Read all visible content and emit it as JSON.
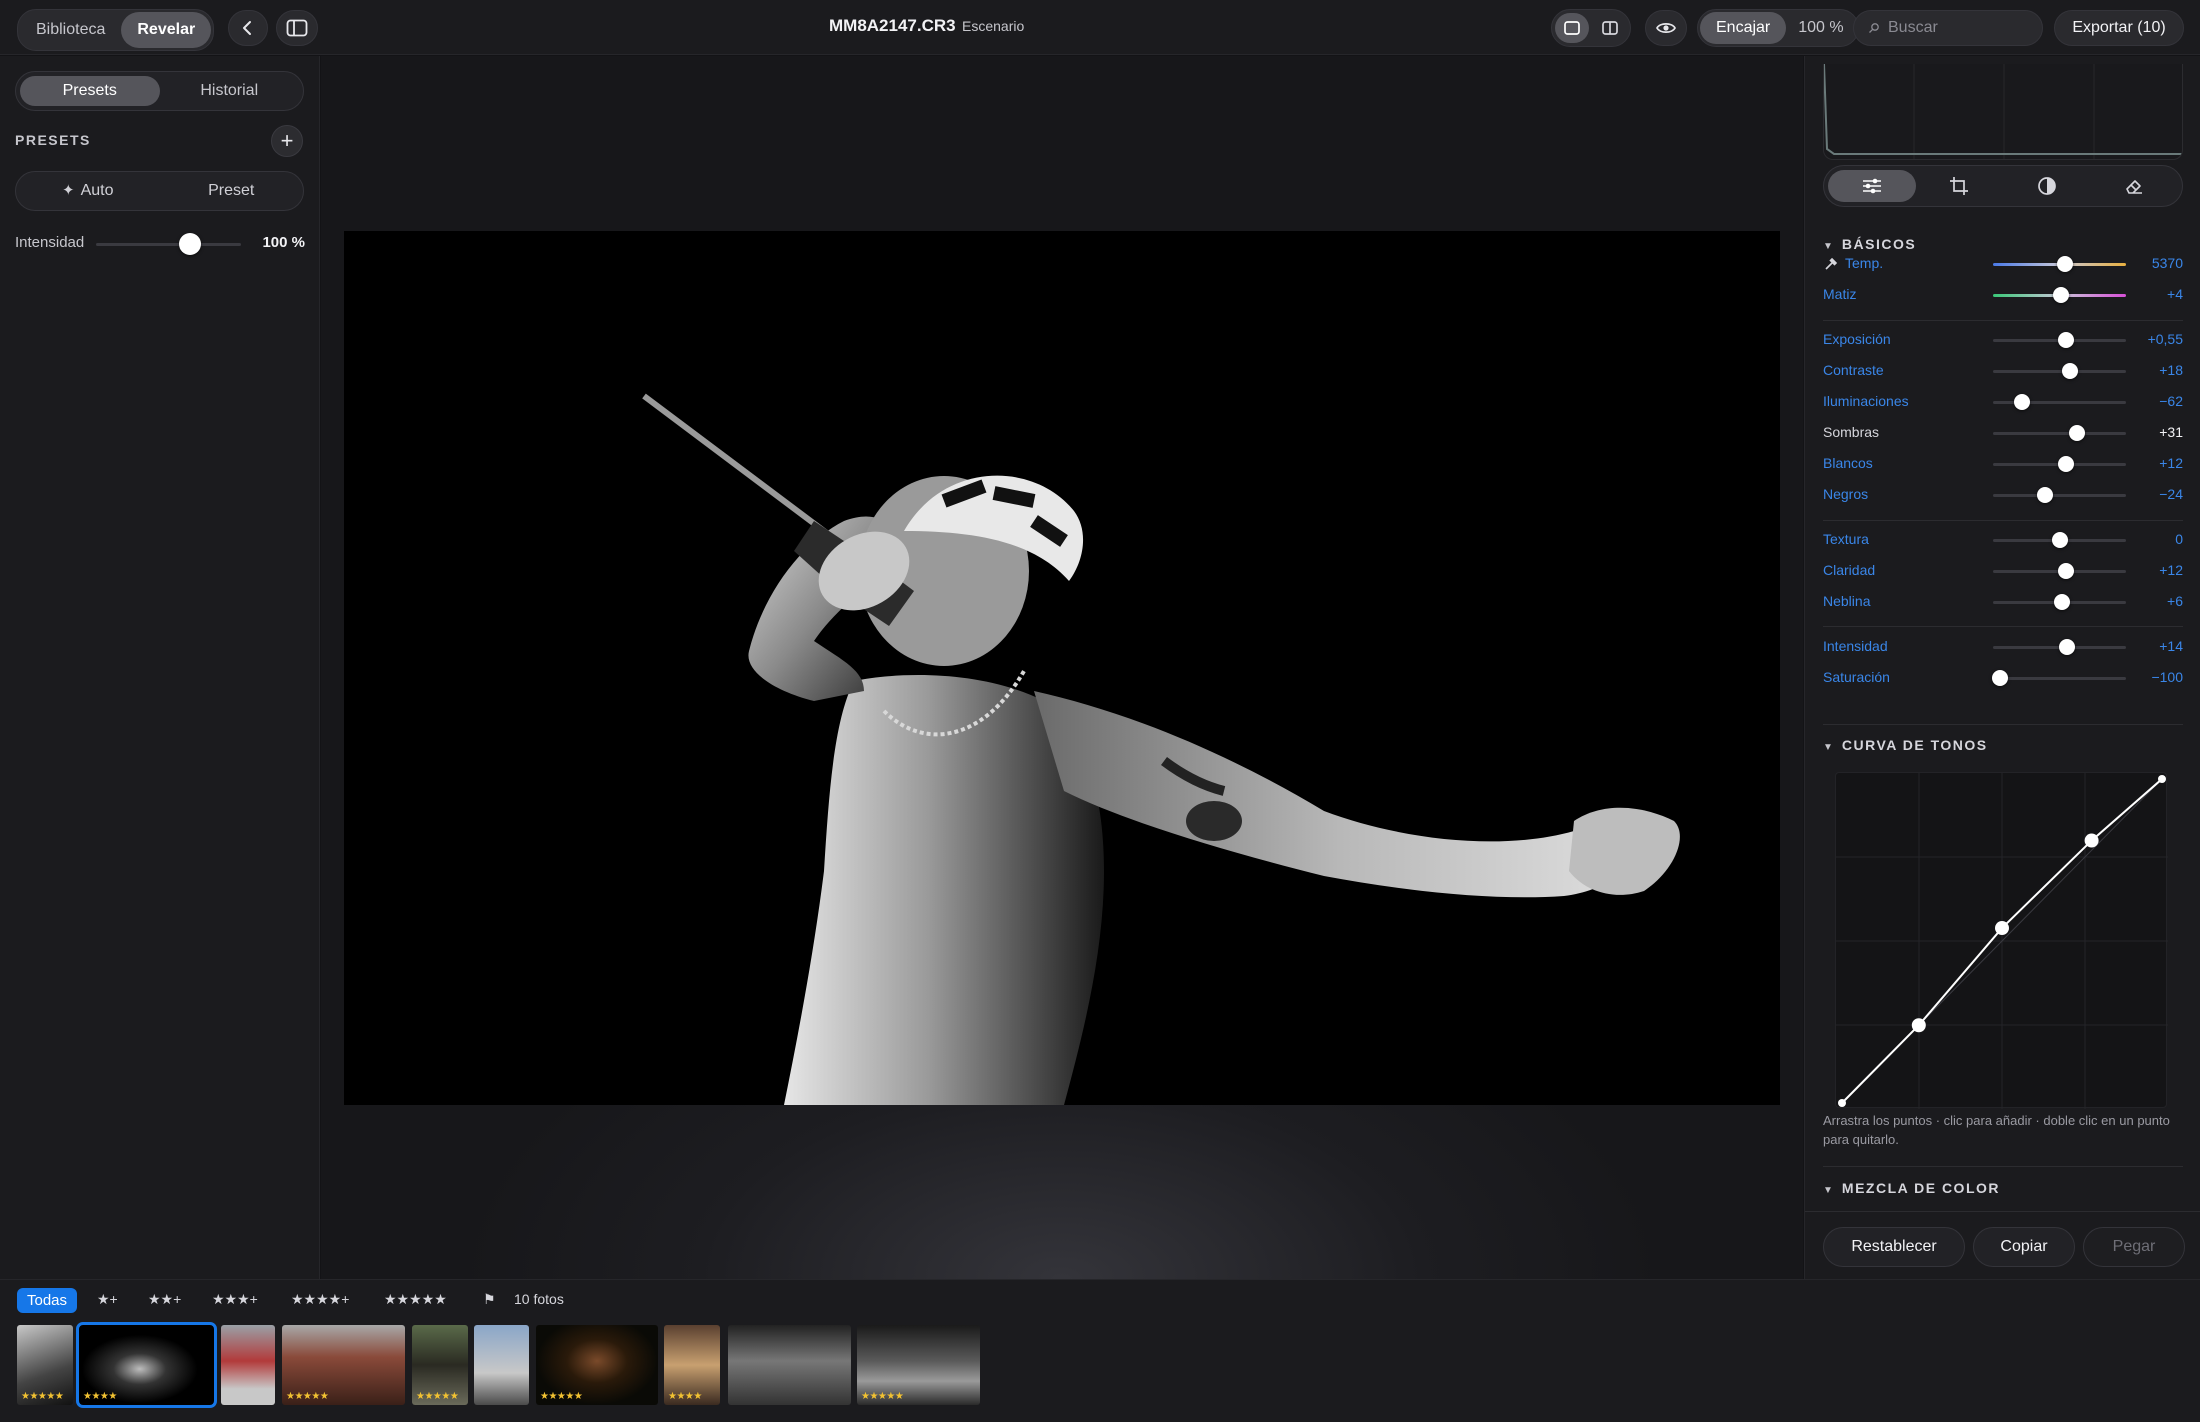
{
  "topbar": {
    "mode_tabs": [
      "Biblioteca",
      "Revelar"
    ],
    "file_title": "MM8A2147.CR3",
    "file_subtitle": "Escenario",
    "fit_label": "Encajar",
    "zoom_label": "100 %",
    "search_placeholder": "Buscar",
    "export_label": "Exportar (10)"
  },
  "left": {
    "tabs": [
      "Presets",
      "Historial"
    ],
    "presets_heading": "PRESETS",
    "add_symbol": "+",
    "auto_label": "Auto",
    "preset_label": "Preset",
    "intensity_label": "Intensidad",
    "intensity_value": "100 %",
    "intensity_fraction": 1.0
  },
  "right": {
    "basics_heading": "BÁSICOS",
    "adjustments": [
      {
        "label": "Temp.",
        "value": "5370",
        "pos": 0.54,
        "track": "temp",
        "changed": true
      },
      {
        "label": "Matiz",
        "value": "+4",
        "pos": 0.51,
        "track": "tint",
        "changed": true
      },
      {
        "label": "Exposición",
        "value": "+0,55",
        "pos": 0.55,
        "changed": true
      },
      {
        "label": "Contraste",
        "value": "+18",
        "pos": 0.58,
        "changed": true
      },
      {
        "label": "Iluminaciones",
        "value": "−62",
        "pos": 0.22,
        "changed": true
      },
      {
        "label": "Sombras",
        "value": "+31",
        "pos": 0.63,
        "changed": false
      },
      {
        "label": "Blancos",
        "value": "+12",
        "pos": 0.55,
        "changed": true
      },
      {
        "label": "Negros",
        "value": "−24",
        "pos": 0.39,
        "changed": true
      },
      {
        "label": "Textura",
        "value": "0",
        "pos": 0.5,
        "changed": true
      },
      {
        "label": "Claridad",
        "value": "+12",
        "pos": 0.55,
        "changed": true
      },
      {
        "label": "Neblina",
        "value": "+6",
        "pos": 0.52,
        "changed": true
      },
      {
        "label": "Intensidad",
        "value": "+14",
        "pos": 0.56,
        "changed": true
      },
      {
        "label": "Saturación",
        "value": "−100",
        "pos": 0.05,
        "changed": true
      }
    ],
    "curve_heading": "CURVA DE TONOS",
    "curve_points": [
      [
        0,
        0
      ],
      [
        0.24,
        0.24
      ],
      [
        0.5,
        0.54
      ],
      [
        0.78,
        0.81
      ],
      [
        1,
        1
      ]
    ],
    "curve_hint": "Arrastra los puntos · clic para añadir · doble clic en un punto para quitarlo.",
    "mix_heading": "MEZCLA DE COLOR",
    "reset_label": "Restablecer",
    "copy_label": "Copiar",
    "paste_label": "Pegar"
  },
  "filmstrip": {
    "filters": [
      "Todas",
      "★+",
      "★★+",
      "★★★+",
      "★★★★+",
      "★★★★★"
    ],
    "flag_symbol": "⚑",
    "count_label": "10 fotos",
    "thumbs": [
      {
        "stars": "★★★★★"
      },
      {
        "stars": "★★★★"
      },
      {
        "stars": ""
      },
      {
        "stars": "★★★★★"
      },
      {
        "stars": "★★★★★"
      },
      {
        "stars": ""
      },
      {
        "stars": "★★★★★"
      },
      {
        "stars": "★★★★"
      },
      {
        "stars": ""
      },
      {
        "stars": "★★★★★"
      }
    ]
  },
  "colors": {
    "accent": "#1677e8",
    "adjusted_label": "#3a86e8",
    "star": "#f2c232"
  }
}
